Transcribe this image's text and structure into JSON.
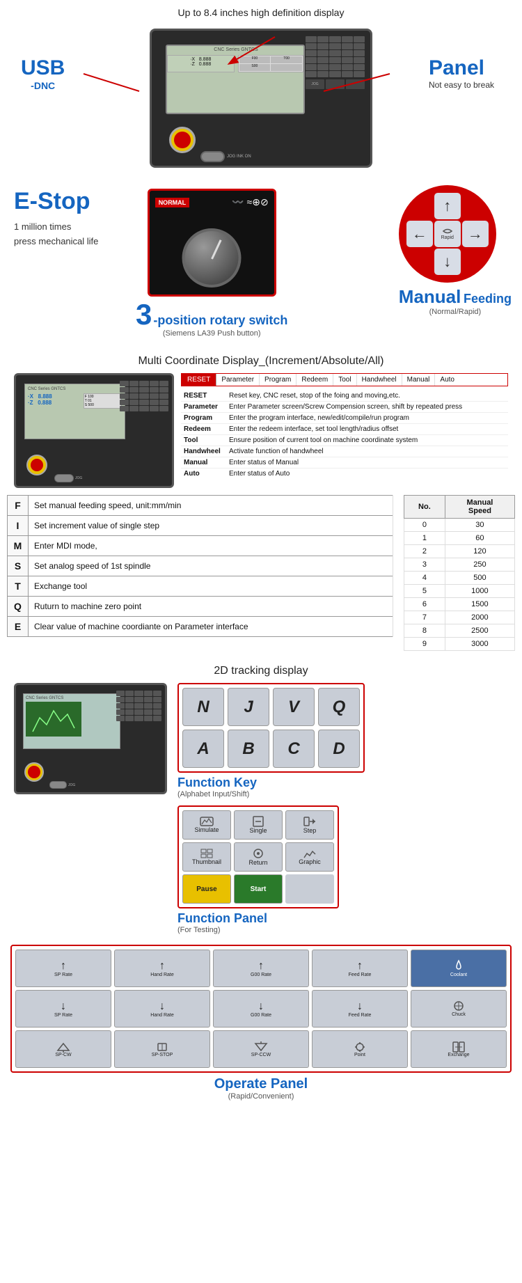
{
  "header": {
    "display_callout": "Up to 8.4 inches high definition display",
    "usb_label": "USB",
    "dnc_label": "-DNC",
    "panel_label": "Panel",
    "panel_sub": "Not easy to break"
  },
  "estop": {
    "title": "E-Stop",
    "desc1": "1 million times",
    "desc2": "press mechanical life"
  },
  "rotary": {
    "number": "3",
    "label": "-position rotary switch",
    "sub": "(Siemens LA39 Push button)",
    "manual_title": "Manual",
    "feeding_title": "Feeding",
    "manual_sub": "(Normal/Rapid)"
  },
  "coord": {
    "title": "Multi Coordinate Display_(Increment/Absolute/All)",
    "x_label": "·X",
    "x_val": "8.888",
    "z_label": "·Z",
    "z_val": "0.888",
    "menu": {
      "items": [
        "RESET",
        "Parameter",
        "Program",
        "Redeem",
        "Tool",
        "Handwheel",
        "Manual",
        "Auto"
      ],
      "descriptions": [
        {
          "key": "RESET",
          "val": "Reset key, CNC reset, stop of the foing and moving,etc."
        },
        {
          "key": "Parameter",
          "val": "Enter Parameter screen/Screw Compension screen, shift by repeated press"
        },
        {
          "key": "Program",
          "val": "Enter the program interface, new/edit/compile/run program"
        },
        {
          "key": "Redeem",
          "val": "Enter the redeem interface, set tool length/radius offset"
        },
        {
          "key": "Tool",
          "val": "Ensure position of current tool on machine coordinate system"
        },
        {
          "key": "Handwheel",
          "val": "Activate function of handwheel"
        },
        {
          "key": "Manual",
          "val": "Enter status of Manual"
        },
        {
          "key": "Auto",
          "val": "Enter status of Auto"
        }
      ]
    }
  },
  "key_functions": {
    "rows": [
      {
        "key": "F",
        "desc": "Set manual feeding speed, unit:mm/min"
      },
      {
        "key": "I",
        "desc": "Set increment value of single step"
      },
      {
        "key": "M",
        "desc": "Enter MDI mode,"
      },
      {
        "key": "S",
        "desc": "Set analog speed of 1st spindle"
      },
      {
        "key": "T",
        "desc": "Exchange tool"
      },
      {
        "key": "Q",
        "desc": "Ruturn to machine zero point"
      },
      {
        "key": "E",
        "desc": "Clear value of machine coordiante on Parameter interface"
      }
    ]
  },
  "speed_table": {
    "col1": "No.",
    "col2": "Manual Speed",
    "rows": [
      {
        "no": "0",
        "speed": "30"
      },
      {
        "no": "1",
        "speed": "60"
      },
      {
        "no": "2",
        "speed": "120"
      },
      {
        "no": "3",
        "speed": "250"
      },
      {
        "no": "4",
        "speed": "500"
      },
      {
        "no": "5",
        "speed": "1000"
      },
      {
        "no": "6",
        "speed": "1500"
      },
      {
        "no": "7",
        "speed": "2000"
      },
      {
        "no": "8",
        "speed": "2500"
      },
      {
        "no": "9",
        "speed": "3000"
      }
    ]
  },
  "tracking": {
    "title": "2D tracking display"
  },
  "func_keys": {
    "label": "Function Key",
    "sub": "(Alphabet Input/Shift)",
    "keys": [
      "N",
      "J",
      "V",
      "Q",
      "A",
      "B",
      "C",
      "D"
    ]
  },
  "func_panel": {
    "label": "Function Panel",
    "sub": "(For Testing)",
    "buttons": [
      "Simulate",
      "Single",
      "Step",
      "Thumbnail",
      "Return",
      "Graphic",
      "Pause",
      "Start"
    ]
  },
  "operate_panel": {
    "label": "Operate Panel",
    "sub": "(Rapid/Convenient)",
    "row1": [
      {
        "arrow": "↑",
        "label": "SP Rate"
      },
      {
        "arrow": "↑",
        "label": "Hand Rate"
      },
      {
        "arrow": "↑",
        "label": "G00 Rate"
      },
      {
        "arrow": "↑",
        "label": "Feed Rate"
      },
      {
        "label": "Coolant"
      }
    ],
    "row2": [
      {
        "arrow": "↓",
        "label": "SP Rate"
      },
      {
        "arrow": "↓",
        "label": "Hand Rate"
      },
      {
        "arrow": "↓",
        "label": "G00 Rate"
      },
      {
        "arrow": "↓",
        "label": "Feed Rate"
      },
      {
        "label": "Chuck"
      }
    ],
    "row3": [
      {
        "label": "SP-CW"
      },
      {
        "label": "SP-STOP"
      },
      {
        "label": "SP-CCW"
      },
      {
        "label": "Point"
      },
      {
        "label": "Exchange"
      }
    ]
  }
}
